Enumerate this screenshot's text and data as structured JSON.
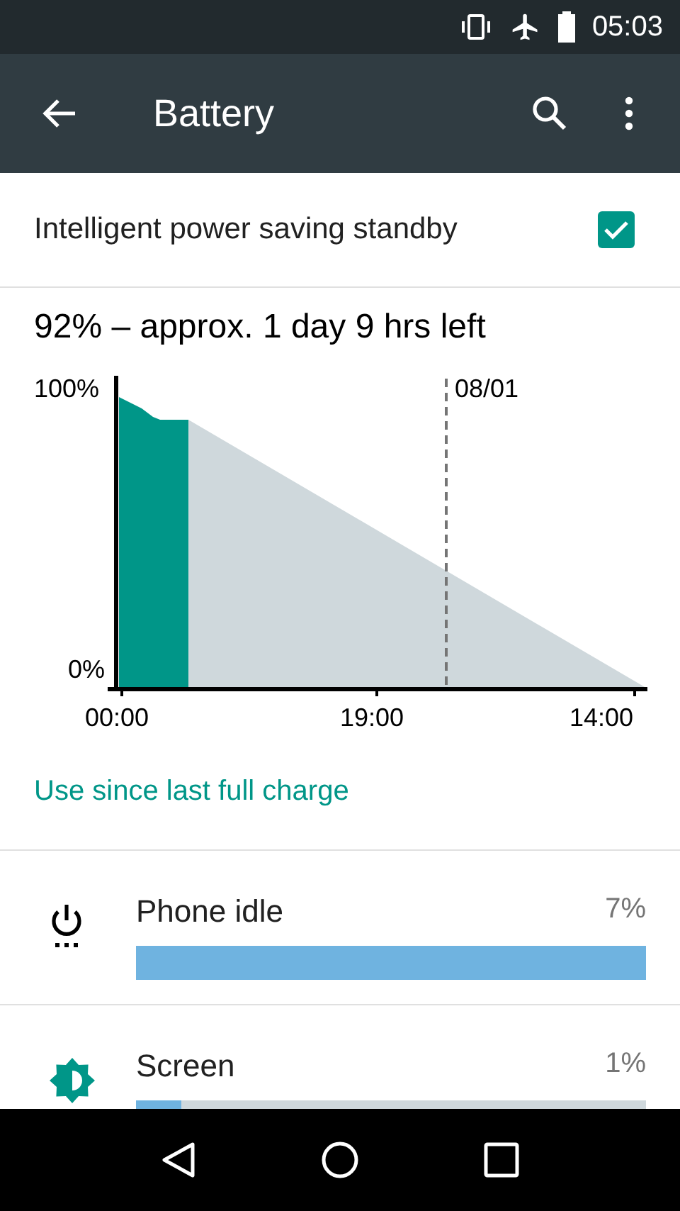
{
  "status_bar": {
    "time": "05:03"
  },
  "toolbar": {
    "title": "Battery"
  },
  "setting": {
    "label": "Intelligent power saving standby",
    "checked": true
  },
  "summary": "92% – approx. 1 day 9 hrs left",
  "graph": {
    "y_labels": [
      "100%",
      "0%"
    ],
    "x_labels": [
      "00:00",
      "19:00",
      "14:00"
    ],
    "marker_label": "08/01"
  },
  "link": "Use since last full charge",
  "usage": [
    {
      "kind": "idle",
      "name": "Phone idle",
      "percent": "7%",
      "level": 1.0
    },
    {
      "kind": "screen",
      "name": "Screen",
      "percent": "1%",
      "level": 0.09
    }
  ]
}
